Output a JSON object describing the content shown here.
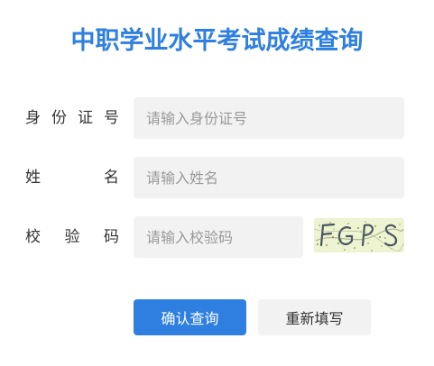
{
  "page": {
    "title": "中职学业水平考试成绩查询"
  },
  "form": {
    "id_number": {
      "label_chars": [
        "身",
        "份",
        "证",
        "号"
      ],
      "placeholder": "请输入身份证号",
      "value": ""
    },
    "name": {
      "label_chars": [
        "姓",
        "名"
      ],
      "placeholder": "请输入姓名",
      "value": ""
    },
    "captcha": {
      "label_chars": [
        "校",
        "验",
        "码"
      ],
      "placeholder": "请输入校验码",
      "value": "",
      "image_text": "FGPS"
    }
  },
  "buttons": {
    "submit_label": "确认查询",
    "reset_label": "重新填写"
  },
  "colors": {
    "accent": "#2f7fe0",
    "input_bg": "#f2f2f2",
    "captcha_bg": "#eef3d2"
  }
}
